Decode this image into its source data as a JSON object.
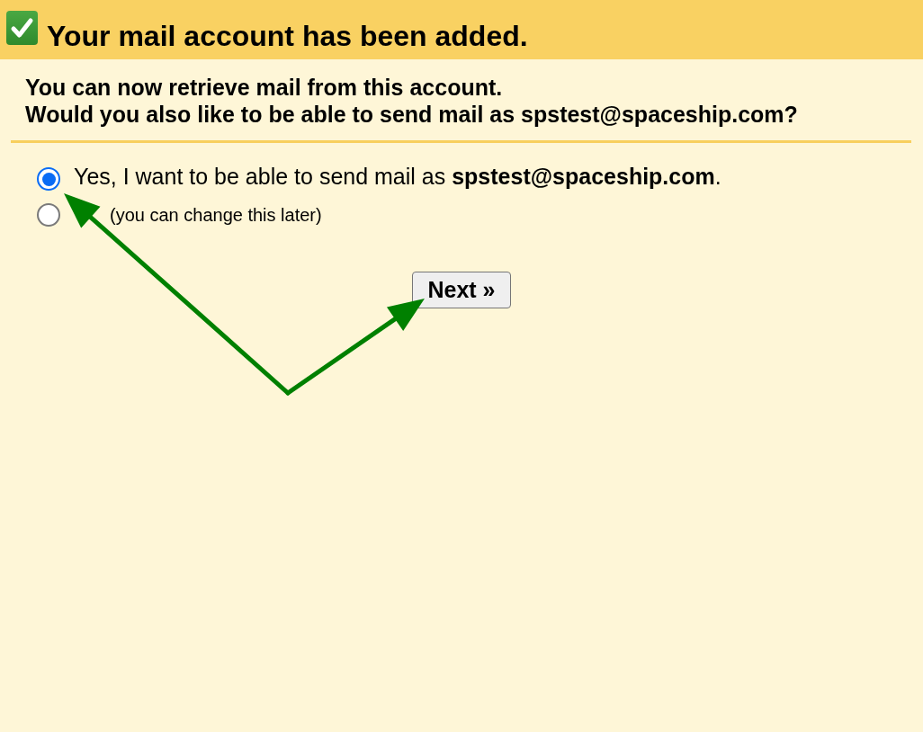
{
  "banner": {
    "title": "Your mail account has been added."
  },
  "message": [
    "You can now retrieve mail from this account.",
    "Would you also like to be able to send mail as spstest@spaceship.com?"
  ],
  "options": [
    {
      "kind": "main",
      "label": "Yes, I want to be able to send mail as **spstest@spaceship.com**.",
      "selected": true
    },
    {
      "kind": "note",
      "label": "(you can change this later)",
      "selected": false
    }
  ],
  "buttons": [
    {
      "label": "Next »"
    }
  ]
}
